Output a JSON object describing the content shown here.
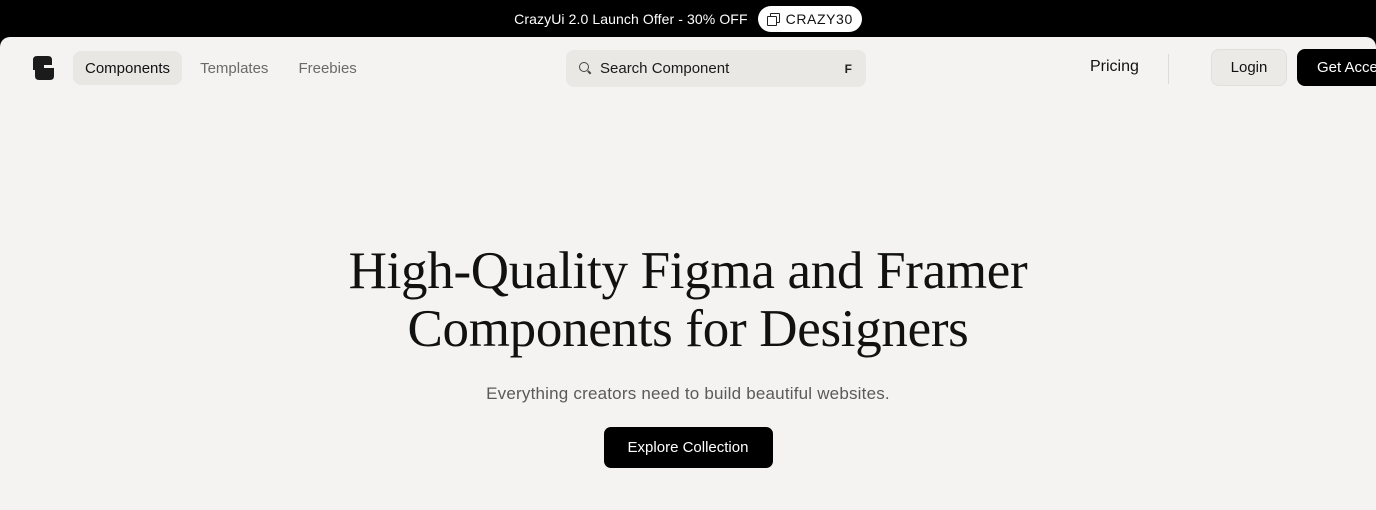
{
  "promo": {
    "text": "CrazyUi 2.0 Launch Offer - 30% OFF",
    "code": "CRAZY30",
    "code_icon": "copy-icon"
  },
  "header": {
    "logo_icon": "brand-logo",
    "nav": [
      {
        "label": "Components",
        "active": true
      },
      {
        "label": "Templates",
        "active": false
      },
      {
        "label": "Freebies",
        "active": false
      }
    ],
    "search": {
      "placeholder": "Search Component",
      "shortcut": "F",
      "icon": "search-icon"
    },
    "pricing_label": "Pricing",
    "login_label": "Login",
    "cta_label": "Get Access"
  },
  "hero": {
    "title_line1": "High-Quality Figma and Framer",
    "title_line2": "Components for Designers",
    "subtitle": "Everything creators need to build beautiful websites.",
    "button_label": "Explore Collection"
  },
  "colors": {
    "background": "#f4f3f1",
    "accent": "#000000",
    "nav_active_bg": "#e8e7e4"
  }
}
